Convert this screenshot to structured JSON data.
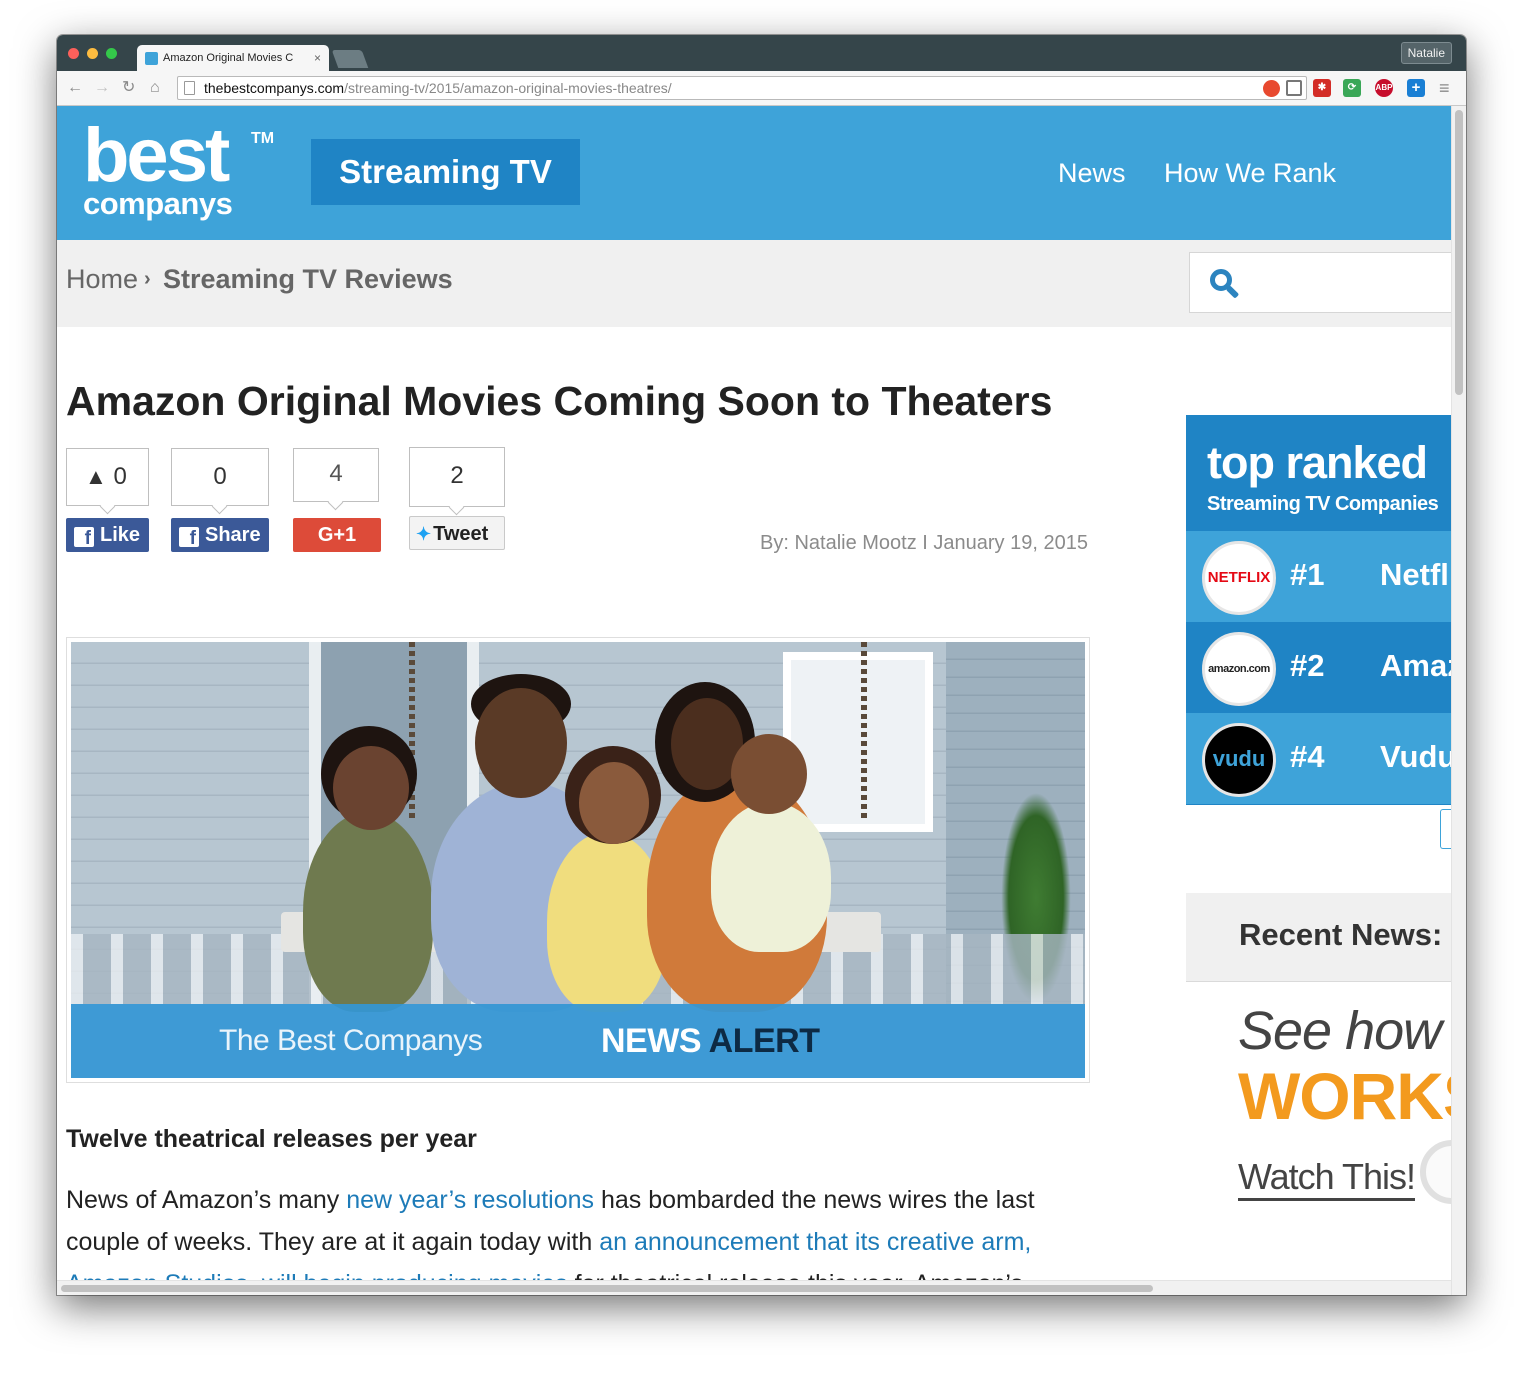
{
  "browser": {
    "tab_title": "Amazon Original Movies C",
    "tab_close": "×",
    "profile_name": "Natalie",
    "url_host": "thebestcompanys.com",
    "url_path": "/streaming-tv/2015/amazon-original-movies-theatres/",
    "nav": {
      "back": "←",
      "forward": "→",
      "reload": "↻",
      "home": "⌂"
    },
    "extensions": [
      {
        "name": "block-icon",
        "label": "",
        "color": "#e8492f"
      },
      {
        "name": "lastpass-icon",
        "label": "✱",
        "color": "#d32d27"
      },
      {
        "name": "refresh-ext-icon",
        "label": "⟳",
        "color": "#3aa757"
      },
      {
        "name": "adblock-plus-icon",
        "label": "ABP",
        "color": "#c70d2c"
      },
      {
        "name": "plus-ext-icon",
        "label": "+",
        "color": "#1a7fd4"
      }
    ],
    "menu": "≡"
  },
  "site": {
    "logo_best": "best",
    "logo_tm": "TM",
    "logo_companys": "companys",
    "section": "Streaming TV",
    "nav": [
      "News",
      "How We Rank"
    ]
  },
  "breadcrumb": {
    "home": "Home",
    "separator": "›",
    "current": "Streaming TV Reviews"
  },
  "article": {
    "title": "Amazon Original Movies Coming Soon to Theaters",
    "social": {
      "like_count": "0",
      "share_count": "0",
      "gplus_count": "4",
      "tweet_count": "2",
      "like_label": "Like",
      "share_label": "Share",
      "gplus_label": "G+1",
      "tweet_label": "Tweet"
    },
    "byline": "By: Natalie Mootz  I  January 19, 2015",
    "hero": {
      "band_left": "The Best Companys",
      "band_news": "NEWS",
      "band_alert": " ALERT"
    },
    "subheading": "Twelve theatrical releases per year",
    "paragraph": {
      "t1": "News of Amazon’s many ",
      "l1": "new year’s resolutions",
      "t2": " has bombarded the news wires the last couple of weeks. They are at it again today with ",
      "l2": "an announcement that its creative arm, Amazon Studios, will begin producing movies",
      "t3": " for theatrical release this year. Amazon’s"
    }
  },
  "sidebar": {
    "ranked_title": "top ranked",
    "ranked_subtitle": "Streaming TV Companies",
    "companies": [
      {
        "logo": "NETFLIX",
        "rank": "#1",
        "name": "Netflix"
      },
      {
        "logo": "amazon.com Prime",
        "rank": "#2",
        "name": "Amazon"
      },
      {
        "logo": "vudu",
        "rank": "#4",
        "name": "Vudu"
      }
    ],
    "recent_title": "Recent News:",
    "promo_line1": "See how",
    "promo_line2": "WORKS",
    "promo_cta": "Watch This!"
  }
}
